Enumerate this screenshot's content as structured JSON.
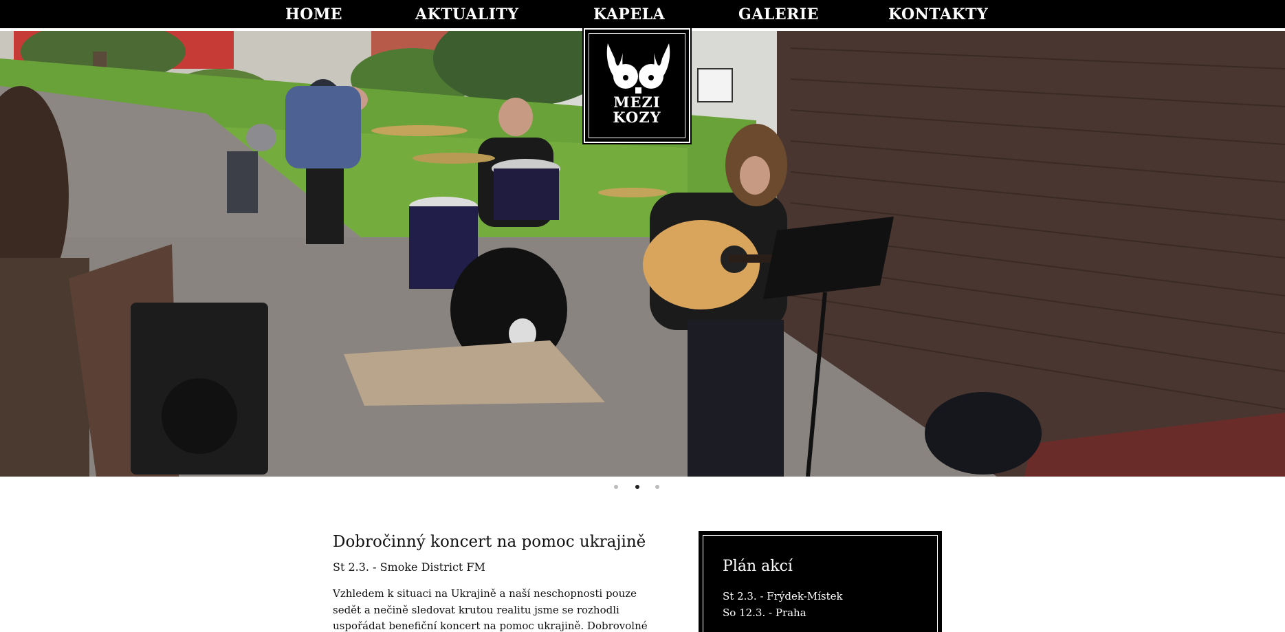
{
  "nav": {
    "items": [
      "HOME",
      "AKTUALITY",
      "KAPELA",
      "GALERIE",
      "KONTAKTY"
    ]
  },
  "logo": {
    "line1": "MEZI",
    "line2": "KOZY"
  },
  "hero": {
    "image_description_icon": "band-photo",
    "slide_count": 3,
    "active_slide": 2
  },
  "article": {
    "title": "Dobročinný koncert na pomoc ukrajině",
    "subtitle": "St 2.3. - Smoke District FM",
    "body": "Vzhledem k situaci na Ukrajině a naší neschopnosti pouze sedět a nečině sledovat krutou realitu jsme se rozhodli uspořádat benefiční koncert na pomoc ukrajině. Dobrovolné vstupné a část"
  },
  "sidebar": {
    "title": "Plán akcí",
    "events": [
      "St 2.3. - Frýdek-Místek",
      "So 12.3. - Praha"
    ]
  },
  "colors": {
    "nav_bg": "#000000",
    "sidebar_bg": "#000000",
    "active_dot": "#222222",
    "inactive_dot": "#bbbbbb"
  }
}
